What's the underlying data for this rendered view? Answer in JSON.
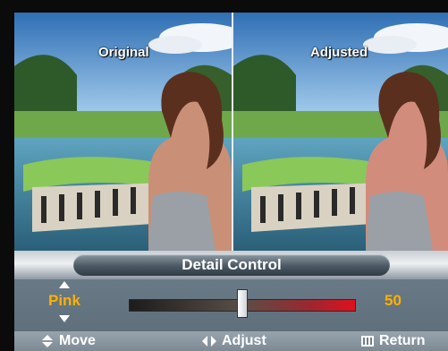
{
  "preview": {
    "left_label": "Original",
    "right_label": "Adjusted"
  },
  "menu": {
    "title": "Detail Control",
    "item_label": "Pink",
    "item_value": "50",
    "slider_level": 0.5
  },
  "footer": {
    "move_label": "Move",
    "adjust_label": "Adjust",
    "return_label": "Return",
    "move_icon": "up-down-arrows-icon",
    "adjust_icon": "left-right-arrows-icon",
    "return_icon": "menu-icon"
  },
  "colors": {
    "accent": "#ffb000",
    "panel": "#5b6c78"
  }
}
